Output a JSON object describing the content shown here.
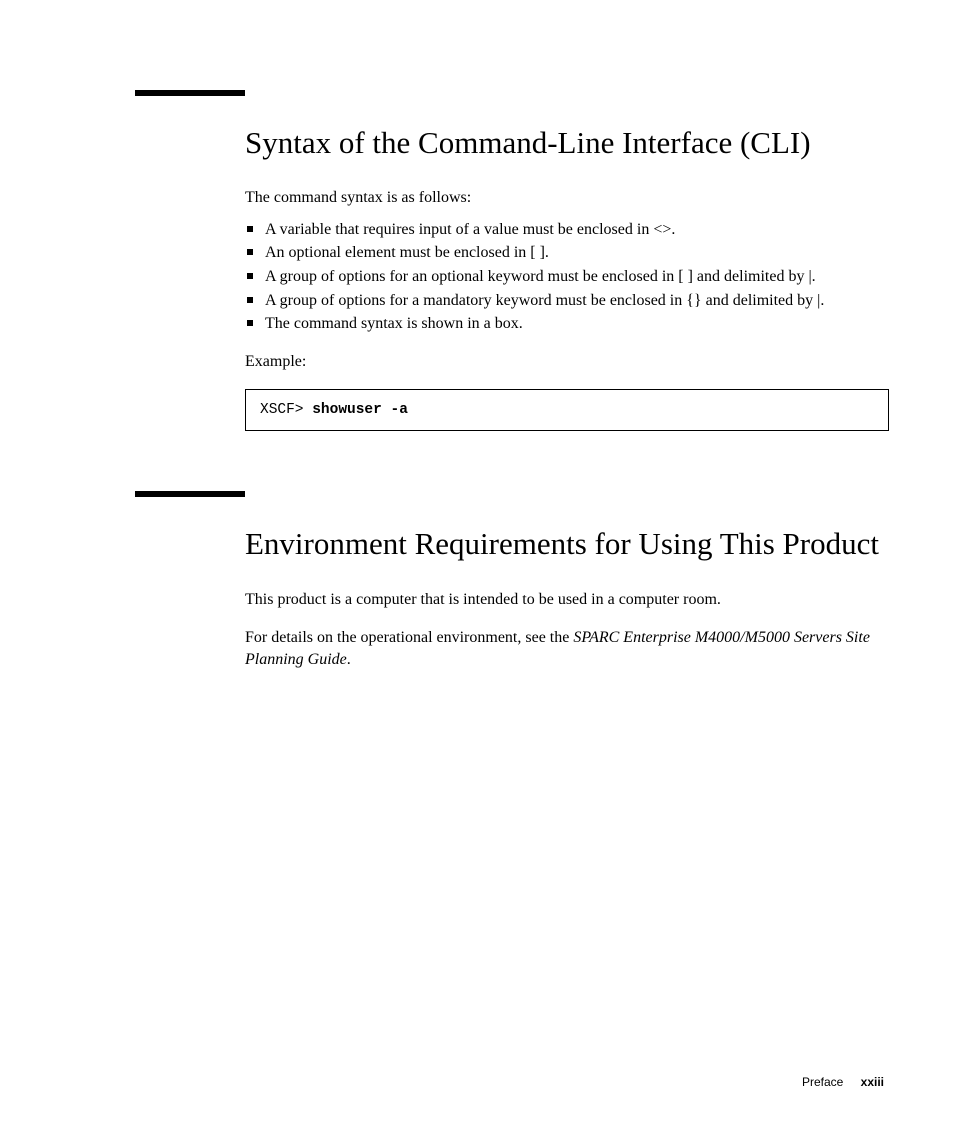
{
  "section1": {
    "heading": "Syntax of the Command-Line Interface (CLI)",
    "intro": "The command syntax is as follows:",
    "bullets": [
      "A variable that requires input of a value must be enclosed in <>.",
      "An optional element must be enclosed in [ ].",
      "A group of options for an optional keyword must be enclosed in [ ] and delimited by |.",
      "A group of options for a mandatory keyword must be enclosed in {} and delimited by |.",
      "The command syntax is shown in a box."
    ],
    "example_label": "Example:",
    "code_prompt": "XSCF> ",
    "code_cmd": "showuser -a"
  },
  "section2": {
    "heading": "Environment Requirements for Using This Product",
    "para1": "This product is a computer that is intended to be used in a computer room.",
    "para2_pre": "For details on the operational environment, see the ",
    "para2_italic": "SPARC Enterprise M4000/M5000 Servers Site Planning Guide",
    "para2_post": "."
  },
  "footer": {
    "label": "Preface",
    "page": "xxiii"
  }
}
